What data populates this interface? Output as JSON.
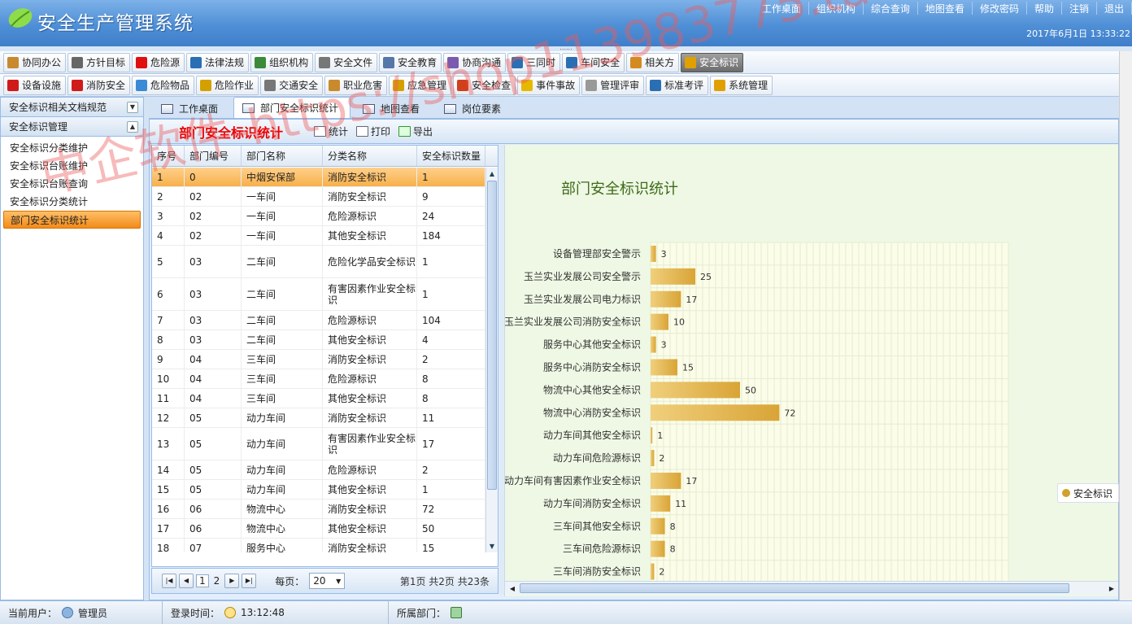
{
  "app": {
    "title": "安全生产管理系统",
    "datetime": "2017年6月1日  13:33:22"
  },
  "toplinks": [
    "工作桌面",
    "组织机构",
    "综合查询",
    "地图查看",
    "修改密码",
    "帮助",
    "注销",
    "退出"
  ],
  "menu1": [
    {
      "label": "协同办公",
      "color": "#c98a2e"
    },
    {
      "label": "方针目标",
      "color": "#666"
    },
    {
      "label": "危险源",
      "color": "#e01010"
    },
    {
      "label": "法律法规",
      "color": "#2a6fb3"
    },
    {
      "label": "组织机构",
      "color": "#3a8a3a"
    },
    {
      "label": "安全文件",
      "color": "#777"
    },
    {
      "label": "安全教育",
      "color": "#5577aa"
    },
    {
      "label": "协商沟通",
      "color": "#7a5bb0"
    },
    {
      "label": "三同时",
      "color": "#2a6fb3"
    },
    {
      "label": "车间安全",
      "color": "#2a6fb3"
    },
    {
      "label": "相关方",
      "color": "#d48a20"
    },
    {
      "label": "安全标识",
      "color": "#e0a000",
      "active": true
    }
  ],
  "menu2": [
    {
      "label": "设备设施",
      "color": "#d01a1a"
    },
    {
      "label": "消防安全",
      "color": "#d01a1a"
    },
    {
      "label": "危险物品",
      "color": "#3b8ad6"
    },
    {
      "label": "危险作业",
      "color": "#d4a000"
    },
    {
      "label": "交通安全",
      "color": "#777"
    },
    {
      "label": "职业危害",
      "color": "#c98a2e"
    },
    {
      "label": "应急管理",
      "color": "#d4a000"
    },
    {
      "label": "安全检查",
      "color": "#d0401a"
    },
    {
      "label": "事件事故",
      "color": "#e6b800"
    },
    {
      "label": "管理评审",
      "color": "#999"
    },
    {
      "label": "标准考评",
      "color": "#2a6fb3"
    },
    {
      "label": "系统管理",
      "color": "#e0a000"
    }
  ],
  "sidebar": {
    "group1": "安全标识相关文档规范",
    "group2": "安全标识管理",
    "items": [
      "安全标识分类维护",
      "安全标识台账维护",
      "安全标识台账查询",
      "安全标识分类统计",
      "部门安全标识统计"
    ],
    "active_index": 4
  },
  "tabs": [
    "工作桌面",
    "部门安全标识统计",
    "地图查看",
    "岗位要素"
  ],
  "active_tab": 1,
  "toolbar": {
    "title": "部门安全标识统计",
    "stat": "统计",
    "print": "打印",
    "export": "导出"
  },
  "grid": {
    "headers": [
      "序号",
      "部门编号",
      "部门名称",
      "分类名称",
      "安全标识数量"
    ],
    "rows": [
      [
        "1",
        "0",
        "中烟安保部",
        "消防安全标识",
        "1"
      ],
      [
        "2",
        "02",
        "一车间",
        "消防安全标识",
        "9"
      ],
      [
        "3",
        "02",
        "一车间",
        "危险源标识",
        "24"
      ],
      [
        "4",
        "02",
        "一车间",
        "其他安全标识",
        "184"
      ],
      [
        "5",
        "03",
        "二车间",
        "危险化学品安全标识",
        "1"
      ],
      [
        "6",
        "03",
        "二车间",
        "有害因素作业安全标识",
        "1"
      ],
      [
        "7",
        "03",
        "二车间",
        "危险源标识",
        "104"
      ],
      [
        "8",
        "03",
        "二车间",
        "其他安全标识",
        "4"
      ],
      [
        "9",
        "04",
        "三车间",
        "消防安全标识",
        "2"
      ],
      [
        "10",
        "04",
        "三车间",
        "危险源标识",
        "8"
      ],
      [
        "11",
        "04",
        "三车间",
        "其他安全标识",
        "8"
      ],
      [
        "12",
        "05",
        "动力车间",
        "消防安全标识",
        "11"
      ],
      [
        "13",
        "05",
        "动力车间",
        "有害因素作业安全标识",
        "17"
      ],
      [
        "14",
        "05",
        "动力车间",
        "危险源标识",
        "2"
      ],
      [
        "15",
        "05",
        "动力车间",
        "其他安全标识",
        "1"
      ],
      [
        "16",
        "06",
        "物流中心",
        "消防安全标识",
        "72"
      ],
      [
        "17",
        "06",
        "物流中心",
        "其他安全标识",
        "50"
      ],
      [
        "18",
        "07",
        "服务中心",
        "消防安全标识",
        "15"
      ]
    ],
    "selected": 0
  },
  "pager": {
    "page1": "1",
    "page2": "2",
    "per_page_label": "每页：",
    "per_page": "20",
    "info": "第1页  共2页  共23条"
  },
  "chart_data": {
    "type": "bar",
    "orientation": "horizontal",
    "title": "部门安全标识统计",
    "categories": [
      "设备管理部安全警示",
      "玉兰实业发展公司安全警示",
      "玉兰实业发展公司电力标识",
      "玉兰实业发展公司消防安全标识",
      "服务中心其他安全标识",
      "服务中心消防安全标识",
      "物流中心其他安全标识",
      "物流中心消防安全标识",
      "动力车间其他安全标识",
      "动力车间危险源标识",
      "动力车间有害因素作业安全标识",
      "动力车间消防安全标识",
      "三车间其他安全标识",
      "三车间危险源标识",
      "三车间消防安全标识"
    ],
    "series": [
      {
        "name": "安全标识",
        "values": [
          3,
          25,
          17,
          10,
          3,
          15,
          50,
          72,
          1,
          2,
          17,
          11,
          8,
          8,
          2
        ]
      }
    ],
    "xlim": [
      0,
      200
    ],
    "grid": true,
    "legend": "right",
    "bar_color": "#d9a436"
  },
  "statusbar": {
    "user_label": "当前用户：",
    "user": "管理员",
    "login_label": "登录时间：",
    "login_time": "13:12:48",
    "dept_label": "所属部门："
  },
  "watermark": "中企软件-https://shop113983775.taobao.com"
}
